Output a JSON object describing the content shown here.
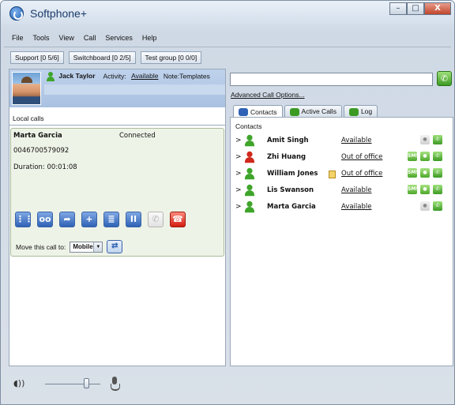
{
  "window": {
    "title": "Softphone+",
    "controls": {
      "minimize": "–",
      "maximize": "□",
      "close": "X"
    }
  },
  "menu": [
    {
      "label": "File"
    },
    {
      "label": "Tools"
    },
    {
      "label": "View"
    },
    {
      "label": "Call"
    },
    {
      "label": "Services"
    },
    {
      "label": "Help"
    }
  ],
  "groups": [
    {
      "label": "Support [0 5/6]"
    },
    {
      "label": "Switchboard [0 2/5]"
    },
    {
      "label": "Test group [0 0/0]"
    }
  ],
  "user": {
    "name": "Jack Taylor",
    "activity_label": "Activity:",
    "activity": "Available",
    "note": "Note:Templates",
    "status_color": "#3ea52a"
  },
  "local_calls": {
    "title": "Local calls",
    "call": {
      "name": "Marta Garcia",
      "status": "Connected",
      "number": "0046700579092",
      "duration": "Duration: 00:01:08"
    },
    "controls": [
      {
        "icon": "keypad-icon",
        "glyph": "⋮⋮",
        "disabled": false
      },
      {
        "icon": "voicemail-icon",
        "glyph": "oo",
        "disabled": false
      },
      {
        "icon": "transfer-icon",
        "glyph": "➦",
        "disabled": false
      },
      {
        "icon": "add-call-icon",
        "glyph": "+",
        "disabled": false
      },
      {
        "icon": "park-call-icon",
        "glyph": "≣",
        "disabled": false
      },
      {
        "icon": "hold-icon",
        "glyph": "II",
        "disabled": false
      },
      {
        "icon": "answer-icon",
        "glyph": "✆",
        "disabled": true
      },
      {
        "icon": "hangup-icon",
        "glyph": "☎",
        "disabled": false
      }
    ],
    "move_label": "Move this call to:",
    "move_value": "Mobile"
  },
  "right": {
    "dial_input_value": "",
    "advanced_link": "Advanced Call Options...",
    "tabs": [
      {
        "label": "Contacts",
        "active": true,
        "icon": "contacts-icon"
      },
      {
        "label": "Active Calls",
        "active": false,
        "icon": "active-calls-icon"
      },
      {
        "label": "Log",
        "active": false,
        "icon": "log-icon"
      }
    ],
    "contacts_heading": "Contacts",
    "contacts": [
      {
        "name": "Amit Singh",
        "status": "Available",
        "color": "#3ea52a",
        "busy": true,
        "note": false,
        "sms": false
      },
      {
        "name": "Zhi Huang",
        "status": "Out of office",
        "color": "#d0281c",
        "busy": false,
        "note": false,
        "sms": true
      },
      {
        "name": "William Jones",
        "status": "Out of office",
        "color": "#3ea52a",
        "busy": false,
        "note": true,
        "sms": true
      },
      {
        "name": "Lis Swanson",
        "status": "Available",
        "color": "#3ea52a",
        "busy": false,
        "note": false,
        "sms": true
      },
      {
        "name": "Marta Garcia",
        "status": "Available",
        "color": "#3ea52a",
        "busy": false,
        "note": false,
        "sms": false
      }
    ]
  },
  "audio": {
    "volume": 0.75
  }
}
